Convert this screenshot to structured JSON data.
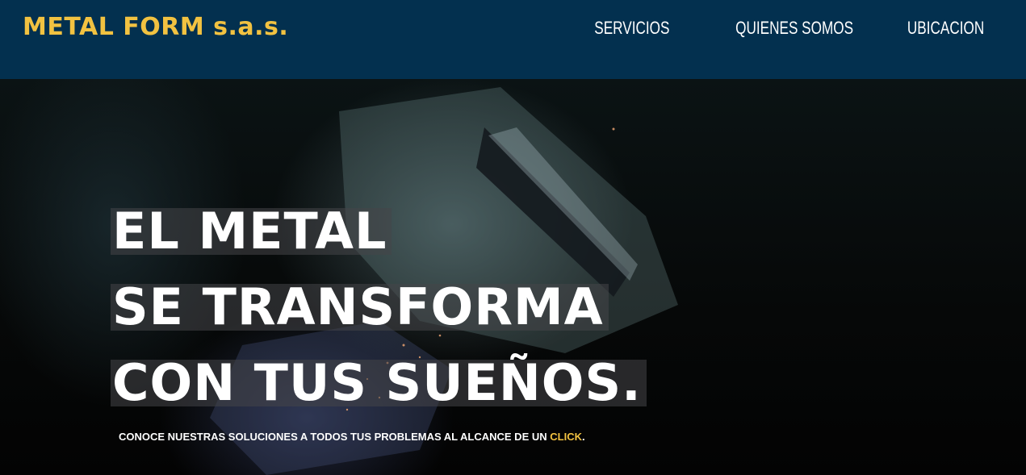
{
  "header": {
    "brand": "METAL FORM s.a.s.",
    "nav": [
      {
        "label": "SERVICIOS"
      },
      {
        "label": "QUIENES SOMOS"
      },
      {
        "label": "UBICACION"
      }
    ]
  },
  "hero": {
    "headline": [
      "EL METAL",
      "SE TRANSFORMA",
      "CON TUS SUEÑOS."
    ],
    "tagline_text": "CONOCE NUESTRAS SOLUCIONES A TODOS TUS PROBLEMAS AL ALCANCE DE UN ",
    "tagline_link": "CLICK",
    "tagline_end": "."
  },
  "colors": {
    "header_bg": "#03304f",
    "brand": "#f2c241",
    "accent": "#f2c241"
  }
}
